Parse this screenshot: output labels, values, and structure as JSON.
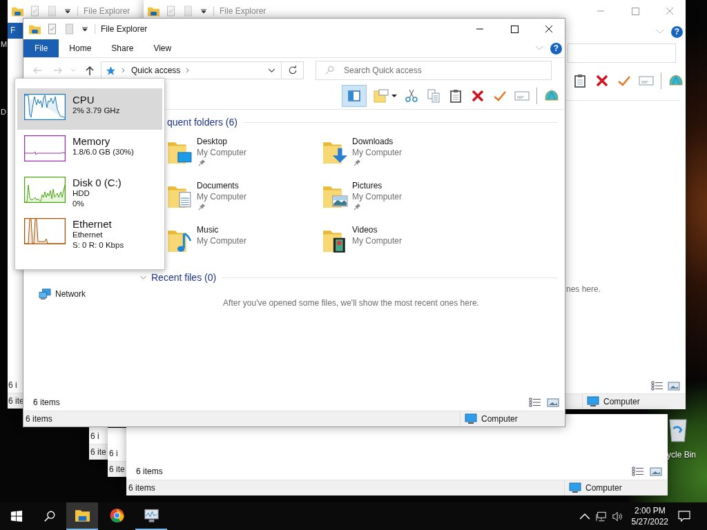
{
  "desktop": {
    "edge_labels": [
      "M",
      "D"
    ],
    "recycle_bin_label": "ycle Bin"
  },
  "window_left": {
    "title": "File Explorer",
    "file_tab": "F",
    "pane_status": "6 i",
    "status_bar": "6 ite"
  },
  "window_right": {
    "title": "File Explorer",
    "help_label": "?",
    "empty_message": "nes here.",
    "status_location": "Computer"
  },
  "stacked_windows": [
    {
      "pane_status": "6 i",
      "status_bar": "6 ite"
    },
    {
      "pane_status": "6 i",
      "status_bar": "6 ite"
    }
  ],
  "window_bottom": {
    "pane_status": "6 items",
    "status_bar": "6 items",
    "status_location": "Computer"
  },
  "window": {
    "title": "File Explorer",
    "help_label": "?",
    "ribbon_tabs": [
      {
        "label": "File",
        "kind": "file"
      },
      {
        "label": "Home",
        "kind": "tab"
      },
      {
        "label": "Share",
        "kind": "tab"
      },
      {
        "label": "View",
        "kind": "tab"
      }
    ],
    "address": {
      "location": "Quick access"
    },
    "search": {
      "placeholder": "Search Quick access"
    },
    "preview_pane_on": true,
    "nav_items": [
      {
        "label": "Network",
        "kind": "network"
      }
    ],
    "frequent": {
      "heading": "quent folders (6)",
      "folders": [
        {
          "name": "Desktop",
          "location": "My Computer",
          "pinned": true,
          "kind": "desktop"
        },
        {
          "name": "Downloads",
          "location": "My Computer",
          "pinned": true,
          "kind": "downloads"
        },
        {
          "name": "Documents",
          "location": "My Computer",
          "pinned": true,
          "kind": "documents"
        },
        {
          "name": "Pictures",
          "location": "My Computer",
          "pinned": true,
          "kind": "pictures"
        },
        {
          "name": "Music",
          "location": "My Computer",
          "pinned": false,
          "kind": "music"
        },
        {
          "name": "Videos",
          "location": "My Computer",
          "pinned": false,
          "kind": "videos"
        }
      ]
    },
    "recent": {
      "heading": "Recent files (0)",
      "empty_message": "After you've opened some files, we'll show the most recent ones here."
    },
    "pane_status": "6 items",
    "status_bar": "6 items",
    "status_location": "Computer"
  },
  "performance_flyout": {
    "items": [
      {
        "name": "CPU",
        "details": [
          "2%  3.79 GHz"
        ],
        "color": "#1f7ab8",
        "selected": true
      },
      {
        "name": "Memory",
        "details": [
          "1.8/6.0 GB (30%)"
        ],
        "color": "#9b2fae",
        "selected": false
      },
      {
        "name": "Disk 0 (C:)",
        "details": [
          "HDD",
          "0%"
        ],
        "color": "#4da60c",
        "selected": false
      },
      {
        "name": "Ethernet",
        "details": [
          "Ethernet",
          "S: 0 R: 0 Kbps"
        ],
        "color": "#a74f01",
        "selected": false
      }
    ]
  },
  "taskbar": {
    "apps": [
      {
        "kind": "explorer",
        "active": true,
        "running": true
      },
      {
        "kind": "chrome",
        "active": false,
        "running": false
      },
      {
        "kind": "task-manager",
        "active": false,
        "running": true
      }
    ],
    "time": "2:00 PM",
    "date": "5/27/2022"
  }
}
